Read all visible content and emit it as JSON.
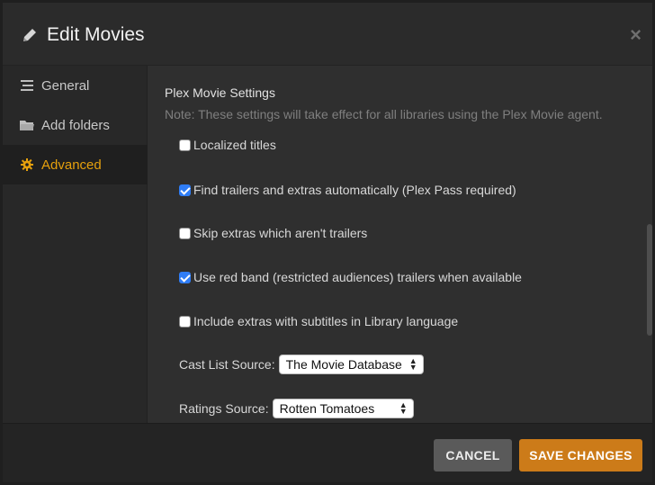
{
  "header": {
    "title": "Edit Movies",
    "close_label": "×",
    "icon": "pencil-icon"
  },
  "sidebar": {
    "items": [
      {
        "label": "General",
        "icon": "list-icon",
        "active": false
      },
      {
        "label": "Add folders",
        "icon": "folder-icon",
        "active": false
      },
      {
        "label": "Advanced",
        "icon": "gear-icon",
        "active": true
      }
    ]
  },
  "content": {
    "section_title": "Plex Movie Settings",
    "note": "Note: These settings will take effect for all libraries using the Plex Movie agent.",
    "options": [
      {
        "label": "Localized titles",
        "checked": false
      },
      {
        "label": "Find trailers and extras automatically (Plex Pass required)",
        "checked": true
      },
      {
        "label": "Skip extras which aren't trailers",
        "checked": false
      },
      {
        "label": "Use red band (restricted audiences) trailers when available",
        "checked": true
      },
      {
        "label": "Include extras with subtitles in Library language",
        "checked": false
      }
    ],
    "cast_list": {
      "label": "Cast List Source:",
      "value": "The Movie Database"
    },
    "ratings": {
      "label": "Ratings Source:",
      "value": "Rotten Tomatoes"
    }
  },
  "footer": {
    "cancel_label": "CANCEL",
    "save_label": "SAVE CHANGES"
  },
  "colors": {
    "accent": "#e5a00d",
    "save_button": "#cc7b19",
    "checkbox_checked": "#2f7df6"
  }
}
